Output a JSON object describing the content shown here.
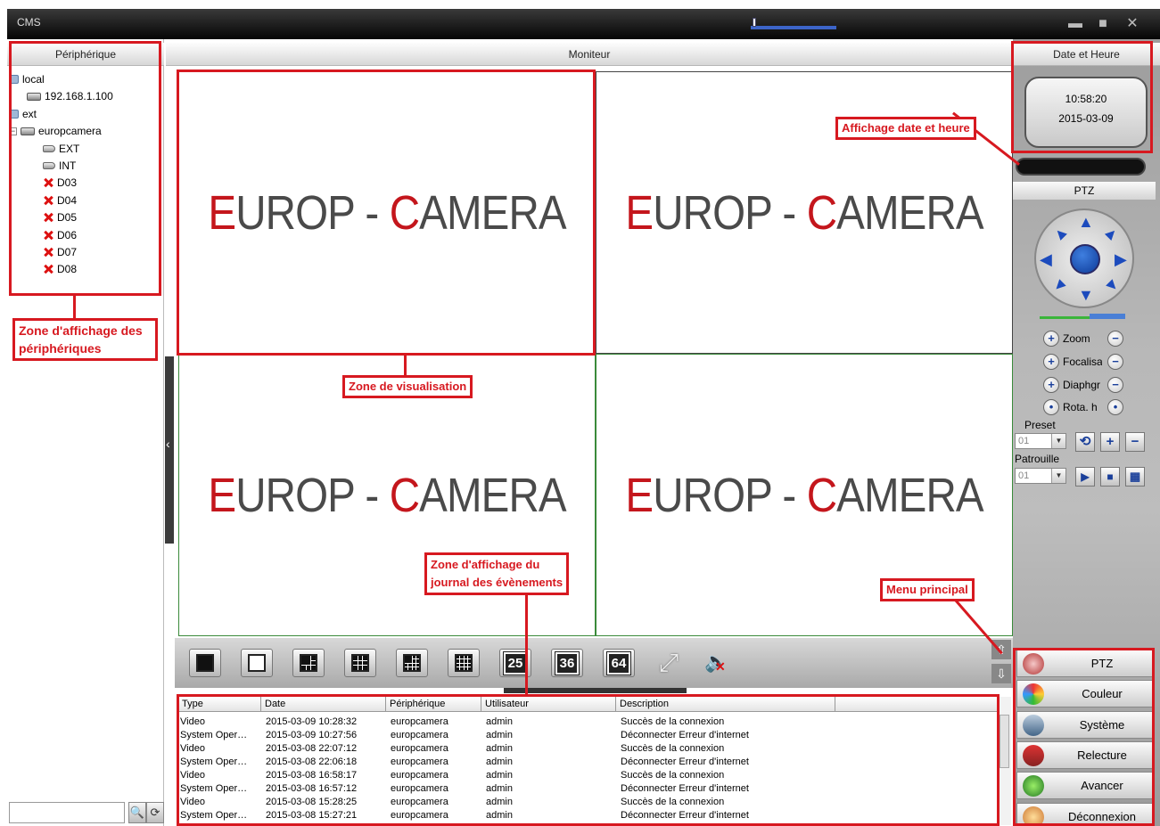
{
  "window": {
    "title": "CMS"
  },
  "headers": {
    "devices": "Périphérique",
    "monitor": "Moniteur",
    "datetime": "Date et Heure",
    "ptz": "PTZ"
  },
  "device_tree": [
    {
      "label": "local",
      "icon": "folder-icon"
    },
    {
      "label": "192.168.1.100",
      "icon": "dvr-icon"
    },
    {
      "label": "ext",
      "icon": "folder-icon"
    },
    {
      "label": "europcamera",
      "icon": "dvr-icon"
    },
    {
      "label": "EXT",
      "icon": "camera-icon"
    },
    {
      "label": "INT",
      "icon": "camera-icon"
    },
    {
      "label": "D03",
      "icon": "camera-offline-icon"
    },
    {
      "label": "D04",
      "icon": "camera-offline-icon"
    },
    {
      "label": "D05",
      "icon": "camera-offline-icon"
    },
    {
      "label": "D06",
      "icon": "camera-offline-icon"
    },
    {
      "label": "D07",
      "icon": "camera-offline-icon"
    },
    {
      "label": "D08",
      "icon": "camera-offline-icon"
    }
  ],
  "video": {
    "logo_part1": "EUROP - ",
    "logo_c": "C",
    "logo_part2": "AMERA",
    "logo_e": "E",
    "logo_rest": "UROP - "
  },
  "layout_buttons": [
    "25",
    "36",
    "64"
  ],
  "clock": {
    "time": "10:58:20",
    "date": "2015-03-09"
  },
  "ptz": {
    "zoom": "Zoom",
    "focus": "Focalisat",
    "iris": "Diaphgr",
    "rotation": "Rota. h",
    "preset_label": "Preset",
    "preset_value": "01",
    "patrol_label": "Patrouille",
    "patrol_value": "01"
  },
  "log": {
    "columns": [
      "Type",
      "Date",
      "Périphérique",
      "Utilisateur",
      "Description"
    ],
    "rows": [
      [
        "Video",
        "2015-03-09 10:28:32",
        "europcamera",
        "admin",
        "Succès de la connexion"
      ],
      [
        "System Oper…",
        "2015-03-09 10:27:56",
        "europcamera",
        "admin",
        "Déconnecter Erreur d'internet"
      ],
      [
        "Video",
        "2015-03-08 22:07:12",
        "europcamera",
        "admin",
        "Succès de la connexion"
      ],
      [
        "System Oper…",
        "2015-03-08 22:06:18",
        "europcamera",
        "admin",
        "Déconnecter Erreur d'internet"
      ],
      [
        "Video",
        "2015-03-08 16:58:17",
        "europcamera",
        "admin",
        "Succès de la connexion"
      ],
      [
        "System Oper…",
        "2015-03-08 16:57:12",
        "europcamera",
        "admin",
        "Déconnecter Erreur d'internet"
      ],
      [
        "Video",
        "2015-03-08 15:28:25",
        "europcamera",
        "admin",
        "Succès de la connexion"
      ],
      [
        "System Oper…",
        "2015-03-08 15:27:21",
        "europcamera",
        "admin",
        "Déconnecter Erreur d'internet"
      ]
    ]
  },
  "menu": [
    {
      "label": "PTZ",
      "icon": "ptz-icon"
    },
    {
      "label": "Couleur",
      "icon": "color-icon"
    },
    {
      "label": "Système",
      "icon": "system-icon"
    },
    {
      "label": "Relecture",
      "icon": "playback-icon"
    },
    {
      "label": "Avancer",
      "icon": "advanced-icon"
    },
    {
      "label": "Déconnexion",
      "icon": "logout-icon"
    }
  ],
  "annotations": {
    "devices_zone": "Zone d'affichage des périphériques",
    "view_zone": "Zone de visualisation",
    "log_zone_1": "Zone d'affichage du",
    "log_zone_2": "journal des évènements",
    "datetime_zone": "Affichage date et heure",
    "main_menu": "Menu principal"
  },
  "colors": {
    "annotation_red": "#d71920",
    "logo_red": "#c4161c",
    "ptz_blue": "#1c4bbd"
  }
}
